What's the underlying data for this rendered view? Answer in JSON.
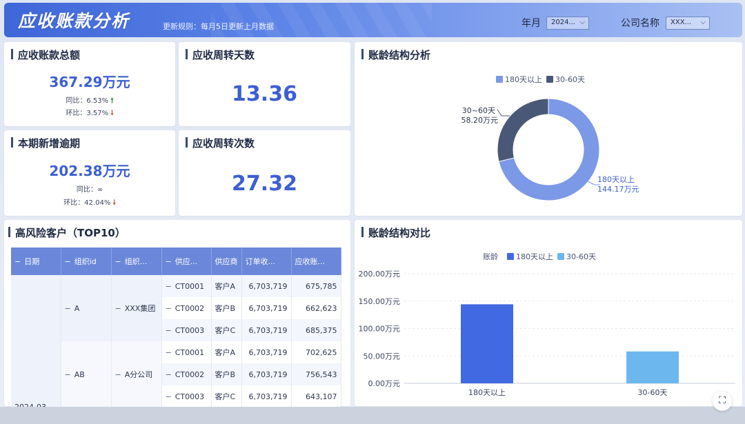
{
  "header": {
    "title": "应收账款分析",
    "update_rule": "更新规则：每月5日更新上月数据",
    "filters": [
      {
        "label": "年月",
        "value": "2024..."
      },
      {
        "label": "公司名称",
        "value": "XXX..."
      }
    ]
  },
  "kpis": {
    "total": {
      "title": "应收账款总额",
      "value": "367.29万元",
      "yoy_label": "同比：6.53%",
      "yoy_direction": "up",
      "mom_label": "环比：3.57%",
      "mom_direction": "down"
    },
    "turnover_days": {
      "title": "应收周转天数",
      "value": "13.36"
    },
    "new_overdue": {
      "title": "本期新增逾期",
      "value": "202.38万元",
      "yoy_label": "同比：∞",
      "mom_label": "环比：42.04%",
      "mom_direction": "down"
    },
    "turnover_times": {
      "title": "应收周转次数",
      "value": "27.32"
    }
  },
  "aging_structure": {
    "title": "账龄结构分析",
    "legend": [
      "180天以上",
      "30-60天"
    ],
    "colors": {
      "over180": "#7b99e6",
      "d30_60": "#4a5878"
    },
    "labels": {
      "d30_60_name": "30~60天",
      "d30_60_value": "58.20万元",
      "over180_name": "180天以上",
      "over180_value": "144.17万元"
    }
  },
  "high_risk": {
    "title": "高风险客户（TOP10）",
    "columns": [
      "日期",
      "组织id",
      "组织...",
      "供应...",
      "供应商",
      "订单收...",
      "应收账..."
    ],
    "date_value": "2024-03",
    "groups": [
      {
        "org_id": "A",
        "org_name": "XXX集团",
        "rows": [
          {
            "code": "CT0001",
            "supplier": "客户A",
            "order": "6,703,719",
            "ar": "675,785"
          },
          {
            "code": "CT0002",
            "supplier": "客户B",
            "order": "6,703,719",
            "ar": "662,623"
          },
          {
            "code": "CT0003",
            "supplier": "客户C",
            "order": "6,703,719",
            "ar": "685,375"
          }
        ]
      },
      {
        "org_id": "AB",
        "org_name": "A分公司",
        "rows": [
          {
            "code": "CT0001",
            "supplier": "客户A",
            "order": "6,703,719",
            "ar": "702,625"
          },
          {
            "code": "CT0002",
            "supplier": "客户B",
            "order": "6,703,719",
            "ar": "756,543"
          },
          {
            "code": "CT0003",
            "supplier": "客户C",
            "order": "6,703,719",
            "ar": "643,107"
          }
        ]
      }
    ]
  },
  "aging_compare": {
    "title": "账龄结构对比",
    "legend_title": "账龄",
    "legend": [
      "180天以上",
      "30-60天"
    ],
    "colors": {
      "over180": "#4169e1",
      "d30_60": "#6cb8ee"
    }
  },
  "chart_data": [
    {
      "type": "pie",
      "title": "账龄结构分析",
      "categories": [
        "180天以上",
        "30-60天"
      ],
      "values": [
        144.17,
        58.2
      ],
      "unit": "万元",
      "donut": true,
      "legend_position": "top"
    },
    {
      "type": "bar",
      "title": "账龄结构对比",
      "categories": [
        "180天以上",
        "30-60天"
      ],
      "values": [
        144.17,
        58.2
      ],
      "colors": [
        "#4169e1",
        "#6cb8ee"
      ],
      "yticks": [
        "0.00万元",
        "50.00万元",
        "100.00万元",
        "150.00万元",
        "200.00万元"
      ],
      "ylim": [
        0,
        200
      ],
      "legend_position": "top",
      "grid": true
    }
  ]
}
